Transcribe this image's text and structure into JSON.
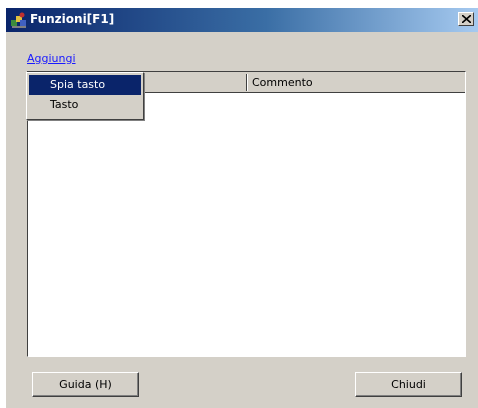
{
  "window": {
    "title": "Funzioni[F1]",
    "icon": "app-icon",
    "close_icon": "close-icon"
  },
  "toolbar": {
    "add_label": "Aggiungi"
  },
  "add_menu": {
    "items": [
      {
        "label": "Spia tasto",
        "selected": true
      },
      {
        "label": "Tasto",
        "selected": false
      }
    ]
  },
  "list": {
    "columns": [
      "",
      "Commento"
    ],
    "rows": []
  },
  "buttons": {
    "help_label": "Guida (H)",
    "close_label": "Chiudi"
  },
  "colors": {
    "titlebar_start": "#0a246a",
    "titlebar_end": "#a6caf0",
    "selection": "#0a246a",
    "face": "#d4d0c8",
    "link": "#1a1aff"
  }
}
